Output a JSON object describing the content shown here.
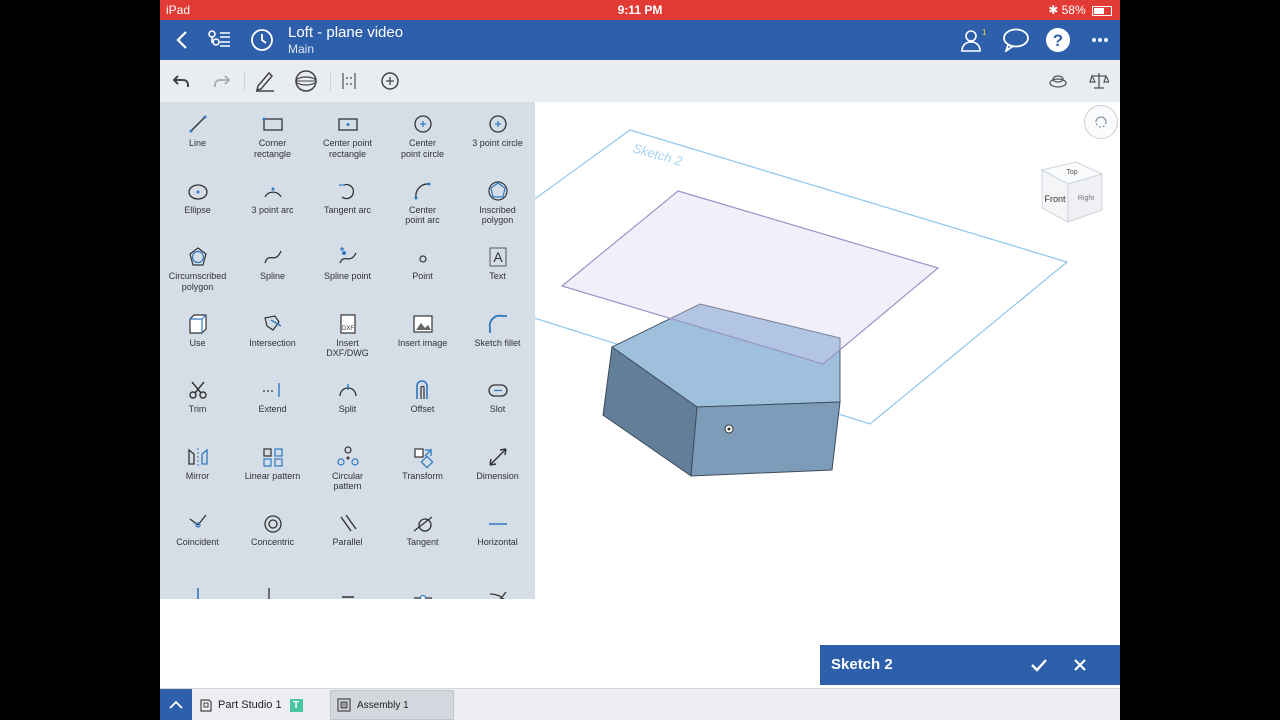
{
  "status": {
    "device": "iPad",
    "time": "9:11 PM",
    "battery": "58%"
  },
  "header": {
    "title": "Loft - plane video",
    "subtitle": "Main"
  },
  "tools": [
    {
      "label": "Line",
      "icon": "line-icon"
    },
    {
      "label": "Corner\nrectangle",
      "icon": "corner-rectangle-icon"
    },
    {
      "label": "Center point\nrectangle",
      "icon": "center-point-rectangle-icon"
    },
    {
      "label": "Center\npoint circle",
      "icon": "center-point-circle-icon"
    },
    {
      "label": "3 point circle",
      "icon": "three-point-circle-icon"
    },
    {
      "label": "Ellipse",
      "icon": "ellipse-icon"
    },
    {
      "label": "3 point arc",
      "icon": "three-point-arc-icon"
    },
    {
      "label": "Tangent arc",
      "icon": "tangent-arc-icon"
    },
    {
      "label": "Center\npoint arc",
      "icon": "center-point-arc-icon"
    },
    {
      "label": "Inscribed\npolygon",
      "icon": "inscribed-polygon-icon"
    },
    {
      "label": "Circumscribed\npolygon",
      "icon": "circumscribed-polygon-icon"
    },
    {
      "label": "Spline",
      "icon": "spline-icon"
    },
    {
      "label": "Spline point",
      "icon": "spline-point-icon"
    },
    {
      "label": "Point",
      "icon": "point-icon"
    },
    {
      "label": "Text",
      "icon": "text-icon"
    },
    {
      "label": "Use",
      "icon": "use-icon"
    },
    {
      "label": "Intersection",
      "icon": "intersection-icon"
    },
    {
      "label": "Insert\nDXF/DWG",
      "icon": "insert-dxf-icon"
    },
    {
      "label": "Insert image",
      "icon": "insert-image-icon"
    },
    {
      "label": "Sketch fillet",
      "icon": "sketch-fillet-icon"
    },
    {
      "label": "Trim",
      "icon": "trim-icon"
    },
    {
      "label": "Extend",
      "icon": "extend-icon"
    },
    {
      "label": "Split",
      "icon": "split-icon"
    },
    {
      "label": "Offset",
      "icon": "offset-icon"
    },
    {
      "label": "Slot",
      "icon": "slot-icon"
    },
    {
      "label": "Mirror",
      "icon": "mirror-icon"
    },
    {
      "label": "Linear pattern",
      "icon": "linear-pattern-icon"
    },
    {
      "label": "Circular\npattern",
      "icon": "circular-pattern-icon"
    },
    {
      "label": "Transform",
      "icon": "transform-icon"
    },
    {
      "label": "Dimension",
      "icon": "dimension-icon"
    },
    {
      "label": "Coincident",
      "icon": "coincident-icon"
    },
    {
      "label": "Concentric",
      "icon": "concentric-icon"
    },
    {
      "label": "Parallel",
      "icon": "parallel-icon"
    },
    {
      "label": "Tangent",
      "icon": "tangent-icon"
    },
    {
      "label": "Horizontal",
      "icon": "horizontal-icon"
    },
    {
      "label": "",
      "icon": "vertical-icon"
    },
    {
      "label": "",
      "icon": "perpendicular-icon"
    },
    {
      "label": "",
      "icon": "equal-icon"
    },
    {
      "label": "",
      "icon": "midpoint-icon"
    },
    {
      "label": "",
      "icon": "normal-icon"
    }
  ],
  "viewport": {
    "sketch_plane_label": "Sketch 2",
    "view_cube": {
      "front": "Front",
      "top": "Top",
      "right": "Right"
    }
  },
  "sketch_panel": {
    "title": "Sketch 2"
  },
  "tabs": [
    {
      "label": "Part Studio 1",
      "badge": "T"
    },
    {
      "label": "Assembly 1"
    }
  ],
  "colors": {
    "accent": "#2e5fab",
    "status_bar": "#e23b36",
    "panel": "#d5dde7",
    "solid": "#7898b6"
  }
}
